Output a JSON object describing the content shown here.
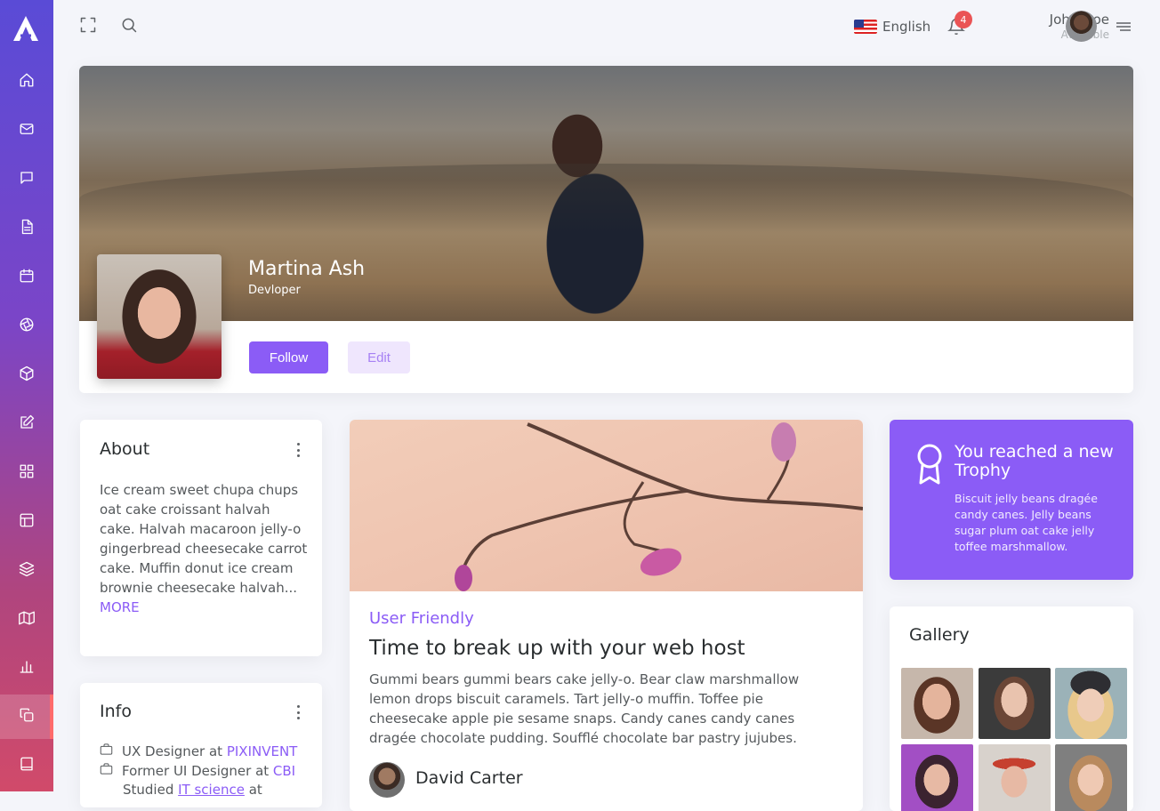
{
  "sidebar": {
    "logo": "A",
    "items": [
      {
        "icon": "home-icon"
      },
      {
        "icon": "mail-icon"
      },
      {
        "icon": "chat-icon"
      },
      {
        "icon": "file-icon"
      },
      {
        "icon": "calendar-icon"
      },
      {
        "icon": "aperture-icon"
      },
      {
        "icon": "box-icon"
      },
      {
        "icon": "edit-icon"
      },
      {
        "icon": "grid-icon"
      },
      {
        "icon": "layout-icon"
      },
      {
        "icon": "layers-icon"
      },
      {
        "icon": "map-icon"
      },
      {
        "icon": "bar-chart-icon"
      },
      {
        "icon": "copy-icon",
        "active": true
      },
      {
        "icon": "book-icon"
      }
    ]
  },
  "topbar": {
    "language": "English",
    "notification_count": "4",
    "user_name": "John Doe",
    "user_status": "Available"
  },
  "profile": {
    "name": "Martina Ash",
    "role": "Devloper",
    "follow_label": "Follow",
    "edit_label": "Edit"
  },
  "about": {
    "title": "About",
    "text": "Ice cream sweet chupa chups oat cake croissant halvah cake. Halvah macaroon jelly-o gingerbread cheesecake carrot cake. Muffin donut ice cream brownie cheesecake halvah...",
    "more": "MORE"
  },
  "info": {
    "title": "Info",
    "rows": [
      {
        "text": "UX Designer at ",
        "link": "PIXINVENT"
      },
      {
        "text": "Former UI Designer at ",
        "link": "CBI"
      },
      {
        "text": "Studied ",
        "link": "IT science",
        "suffix": " at"
      }
    ]
  },
  "blog": {
    "tag": "User Friendly",
    "title": "Time to break up with your web host",
    "text": "Gummi bears gummi bears cake jelly-o. Bear claw marshmallow lemon drops biscuit caramels. Tart jelly-o muffin. Toffee pie cheesecake apple pie sesame snaps. Candy canes candy canes dragée chocolate pudding. Soufflé chocolate bar pastry jujubes.",
    "author": "David Carter"
  },
  "trophy": {
    "title": "You reached a new Trophy",
    "text": "Biscuit jelly beans dragée candy canes. Jelly beans sugar plum oat cake jelly toffee marshmallow."
  },
  "gallery": {
    "title": "Gallery"
  },
  "colors": {
    "primary": "#8b5cf6",
    "badge": "#ea5455"
  }
}
